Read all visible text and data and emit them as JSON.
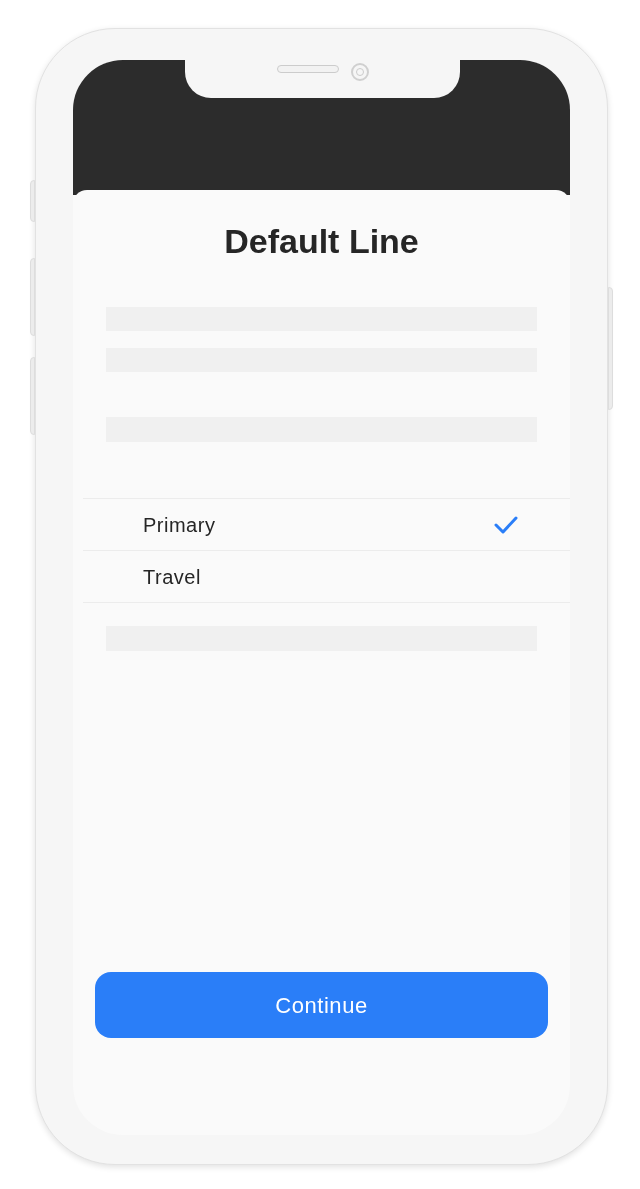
{
  "title": "Default Line",
  "lines": [
    {
      "label": "Primary",
      "selected": true
    },
    {
      "label": "Travel",
      "selected": false
    }
  ],
  "button": {
    "label": "Continue"
  }
}
